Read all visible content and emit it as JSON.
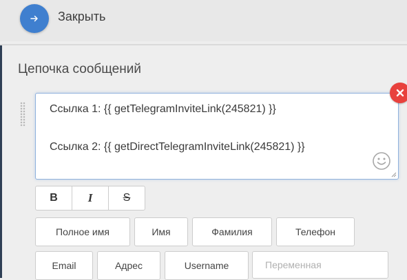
{
  "header": {
    "close_label": "Закрыть"
  },
  "section": {
    "title": "Цепочка сообщений"
  },
  "message": {
    "lines": [
      "Ссылка 1: {{ getTelegramInviteLink(245821) }}",
      "Ссылка 2: {{ getDirectTelegramInviteLink(245821) }}"
    ]
  },
  "formatting": {
    "bold": "B",
    "italic": "I",
    "strike": "S"
  },
  "variables": {
    "buttons": [
      "Полное имя",
      "Имя",
      "Фамилия",
      "Телефон",
      "Email",
      "Адрес",
      "Username"
    ],
    "custom_placeholder": "Переменная"
  },
  "icons": {
    "close": "arrow-right-icon",
    "delete": "close-icon",
    "emoji": "smiley-icon",
    "drag": "drag-handle-icon",
    "resize": "resize-icon"
  },
  "colors": {
    "accent": "#3f7fcf",
    "danger": "#e8413d",
    "focus_border": "#8fb1dc"
  }
}
